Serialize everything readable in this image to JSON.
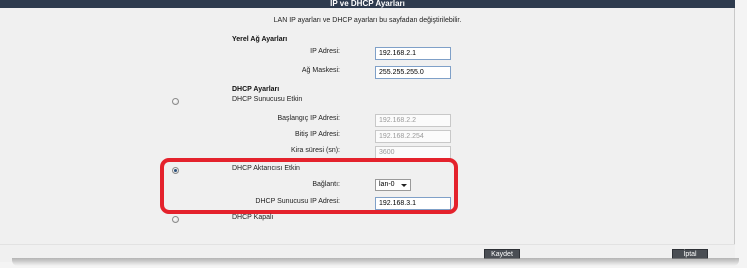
{
  "header": {
    "title": "IP ve DHCP Ayarları"
  },
  "description": "LAN IP ayarları ve DHCP ayarları bu sayfadan değiştirilebilir.",
  "lan": {
    "heading": "Yerel Ağ Ayarları",
    "ip_label": "IP Adresi:",
    "ip_value": "192.168.2.1",
    "mask_label": "Ağ Maskesi:",
    "mask_value": "255.255.255.0"
  },
  "dhcp": {
    "heading": "DHCP Ayarları",
    "server_label": "DHCP Sunucusu Etkin",
    "start_label": "Başlangıç IP Adresi:",
    "start_value": "192.168.2.2",
    "end_label": "Bitiş IP Adresi:",
    "end_value": "192.168.2.254",
    "lease_label": "Kira süresi (sn):",
    "lease_value": "3600",
    "relay_label": "DHCP Aktarıcısı Etkin",
    "connection_label": "Bağlantı:",
    "connection_value": "lan-0",
    "relay_server_label": "DHCP Sunucusu IP Adresi:",
    "relay_server_value": "192.168.3.1",
    "disabled_label": "DHCP Kapalı",
    "selected_mode": "relay"
  },
  "buttons": {
    "save": "Kaydet",
    "cancel": "İptal"
  },
  "colors": {
    "titlebar": "#2e3b4e",
    "highlight": "#e4222c",
    "button": "#4a4e54"
  }
}
